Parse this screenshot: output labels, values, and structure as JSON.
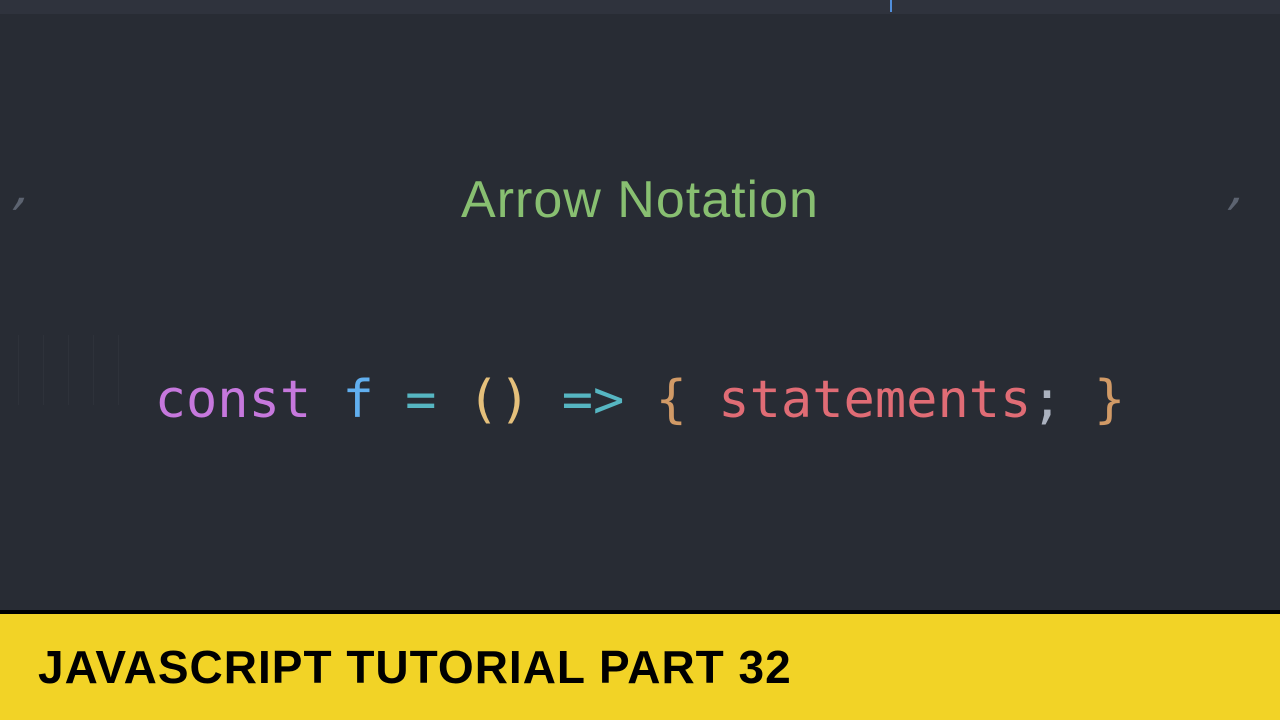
{
  "heading": "Arrow Notation",
  "code": {
    "keyword": "const",
    "name": "f",
    "assign": "=",
    "parens": "()",
    "arrow": "=>",
    "brace_open": "{",
    "statements_word": "statements",
    "semicolon": ";",
    "brace_close": "}"
  },
  "banner": "JAVASCRIPT TUTORIAL PART 32",
  "decorations": {
    "quote_left": "‚",
    "quote_right": "‚"
  }
}
